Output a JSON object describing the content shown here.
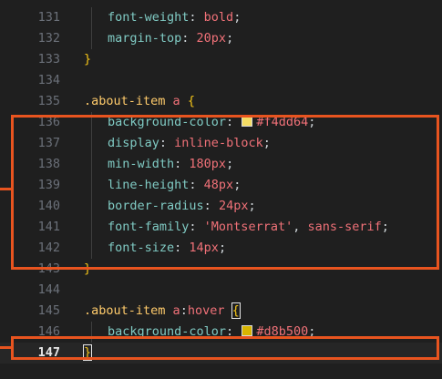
{
  "editor": {
    "colors": {
      "background": "#1f1f1f",
      "highlight_border": "#e8541f",
      "swatch_1": "#f4dd64",
      "swatch_2": "#d8b500"
    },
    "lines": [
      {
        "n": "131",
        "indent": 1,
        "tokens": [
          [
            "prop",
            "font-weight"
          ],
          [
            "punc",
            ": "
          ],
          [
            "val",
            "bold"
          ],
          [
            "punc",
            ";"
          ]
        ]
      },
      {
        "n": "132",
        "indent": 1,
        "tokens": [
          [
            "prop",
            "margin-top"
          ],
          [
            "punc",
            ": "
          ],
          [
            "val",
            "20px"
          ],
          [
            "punc",
            ";"
          ]
        ]
      },
      {
        "n": "133",
        "indent": 0,
        "tokens": [
          [
            "brace",
            "}"
          ]
        ]
      },
      {
        "n": "134",
        "indent": 0,
        "tokens": []
      },
      {
        "n": "135",
        "indent": 0,
        "tokens": [
          [
            "sel-class",
            ".about-item"
          ],
          [
            "punc",
            " "
          ],
          [
            "sel-tag",
            "a"
          ],
          [
            "punc",
            " "
          ],
          [
            "brace",
            "{"
          ]
        ]
      },
      {
        "n": "136",
        "indent": 1,
        "tokens": [
          [
            "prop",
            "background-color"
          ],
          [
            "punc",
            ": "
          ],
          [
            "swatch",
            "#f4dd64"
          ],
          [
            "val",
            "#f4dd64"
          ],
          [
            "punc",
            ";"
          ]
        ]
      },
      {
        "n": "137",
        "indent": 1,
        "tokens": [
          [
            "prop",
            "display"
          ],
          [
            "punc",
            ": "
          ],
          [
            "val",
            "inline-block"
          ],
          [
            "punc",
            ";"
          ]
        ]
      },
      {
        "n": "138",
        "indent": 1,
        "tokens": [
          [
            "prop",
            "min-width"
          ],
          [
            "punc",
            ": "
          ],
          [
            "val",
            "180px"
          ],
          [
            "punc",
            ";"
          ]
        ]
      },
      {
        "n": "139",
        "indent": 1,
        "tokens": [
          [
            "prop",
            "line-height"
          ],
          [
            "punc",
            ": "
          ],
          [
            "val",
            "48px"
          ],
          [
            "punc",
            ";"
          ]
        ]
      },
      {
        "n": "140",
        "indent": 1,
        "tokens": [
          [
            "prop",
            "border-radius"
          ],
          [
            "punc",
            ": "
          ],
          [
            "val",
            "24px"
          ],
          [
            "punc",
            ";"
          ]
        ]
      },
      {
        "n": "141",
        "indent": 1,
        "tokens": [
          [
            "prop",
            "font-family"
          ],
          [
            "punc",
            ": "
          ],
          [
            "val",
            "'Montserrat'"
          ],
          [
            "punc",
            ", "
          ],
          [
            "val",
            "sans-serif"
          ],
          [
            "punc",
            ";"
          ]
        ]
      },
      {
        "n": "142",
        "indent": 1,
        "tokens": [
          [
            "prop",
            "font-size"
          ],
          [
            "punc",
            ": "
          ],
          [
            "val",
            "14px"
          ],
          [
            "punc",
            ";"
          ]
        ]
      },
      {
        "n": "143",
        "indent": 0,
        "tokens": [
          [
            "brace",
            "}"
          ]
        ]
      },
      {
        "n": "144",
        "indent": 0,
        "tokens": []
      },
      {
        "n": "145",
        "indent": 0,
        "tokens": [
          [
            "sel-class",
            ".about-item"
          ],
          [
            "punc",
            " "
          ],
          [
            "sel-tag",
            "a"
          ],
          [
            "punc",
            ":"
          ],
          [
            "sel-tag",
            "hover"
          ],
          [
            "punc",
            " "
          ],
          [
            "brace-box",
            "{"
          ]
        ]
      },
      {
        "n": "146",
        "indent": 1,
        "tokens": [
          [
            "prop",
            "background-color"
          ],
          [
            "punc",
            ": "
          ],
          [
            "swatch",
            "#d8b500"
          ],
          [
            "val",
            "#d8b500"
          ],
          [
            "punc",
            ";"
          ]
        ]
      },
      {
        "n": "147",
        "indent": 0,
        "current": true,
        "tokens": [
          [
            "brace-box",
            "}"
          ]
        ]
      }
    ]
  }
}
